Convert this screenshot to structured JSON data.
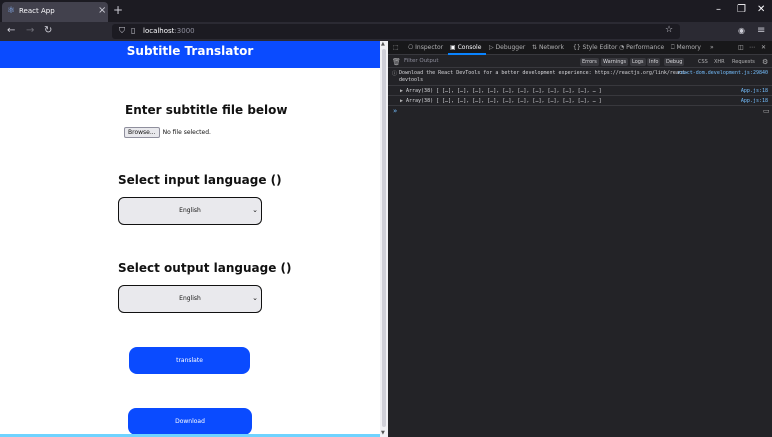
{
  "browser": {
    "tab_title": "React App",
    "tab_close": "×",
    "new_tab": "+",
    "url_host": "localhost",
    "url_port": ":3000",
    "win_min": "–",
    "win_max": "❐",
    "win_close": "✕"
  },
  "page": {
    "app_title": "Subtitle Translator",
    "file_heading": "Enter subtitle file below",
    "browse_label": "Browse...",
    "file_status": "No file selected.",
    "input_lang_heading": "Select input language ()",
    "input_lang_value": "English",
    "output_lang_heading": "Select output language ()",
    "output_lang_value": "English",
    "translate_label": "translate",
    "download_label": "Download"
  },
  "devtools": {
    "tabs": [
      "Inspector",
      "Console",
      "Debugger",
      "Network",
      "Style Editor",
      "Performance",
      "Memory"
    ],
    "active_tab": "Console",
    "filter_placeholder": "Filter Output",
    "levels": [
      "Errors",
      "Warnings",
      "Logs",
      "Info",
      "Debug"
    ],
    "extra_filters": [
      "CSS",
      "XHR",
      "Requests"
    ],
    "messages": [
      {
        "icon": "ⓘ",
        "text": "Download the React DevTools for a better development experience: https://reactjs.org/link/react-",
        "text_line2": "devtools",
        "source": "react-dom.development.js:29840"
      },
      {
        "icon": "▶",
        "text": "Array(38) [ […], […], […], […], […], […], […], […], […], […], … ]",
        "source": "App.js:18"
      },
      {
        "icon": "▶",
        "text": "Array(38) [ […], […], […], […], […], […], […], […], […], […], … ]",
        "source": "App.js:18"
      }
    ],
    "prompt_symbol": "»"
  },
  "colors": {
    "accent": "#0a4bff",
    "devtools_bg": "#232327",
    "chrome_bg": "#1c1b22"
  }
}
